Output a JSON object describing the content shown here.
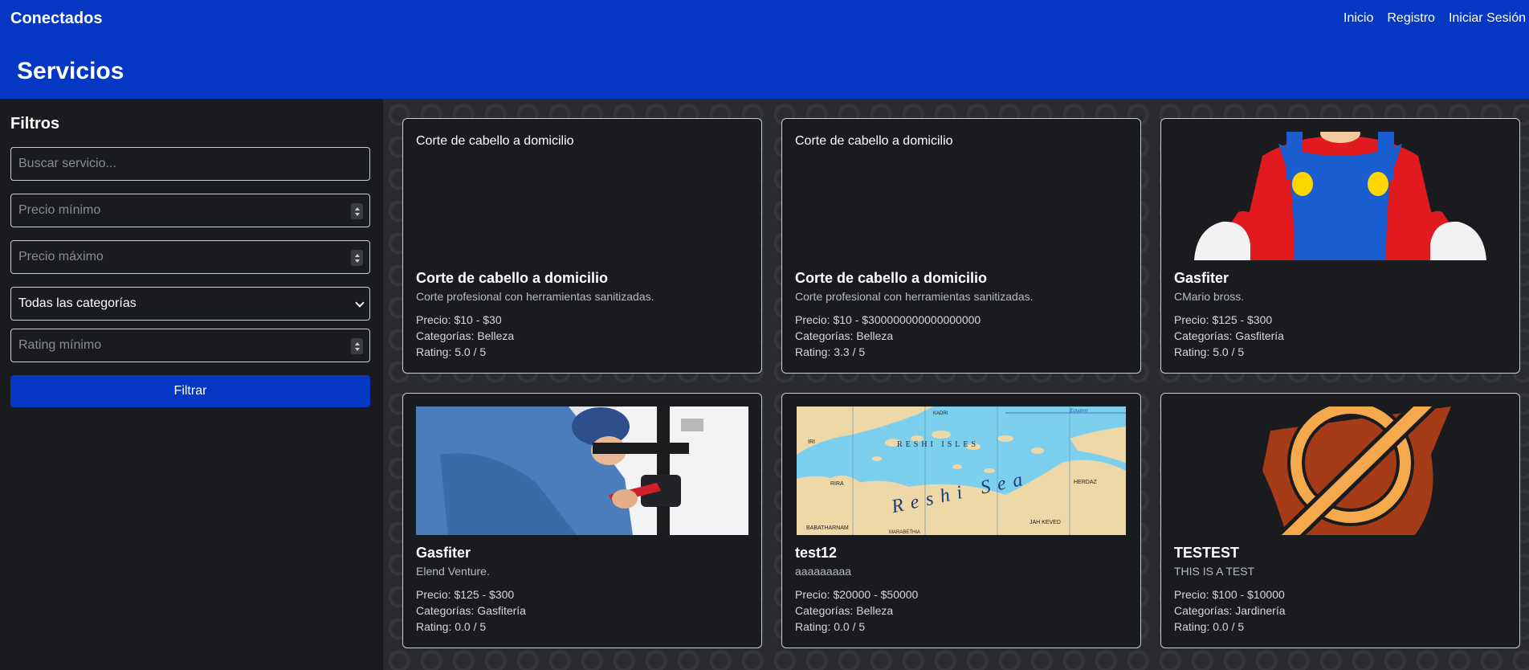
{
  "nav": {
    "brand": "Conectados",
    "links": [
      "Inicio",
      "Registro",
      "Iniciar Sesión"
    ]
  },
  "page": {
    "title": "Servicios"
  },
  "filters": {
    "heading": "Filtros",
    "search_placeholder": "Buscar servicio...",
    "min_price_placeholder": "Precio mínimo",
    "max_price_placeholder": "Precio máximo",
    "category_selected": "Todas las categorías",
    "min_rating_placeholder": "Rating mínimo",
    "button": "Filtrar"
  },
  "services": [
    {
      "image_alt": "Corte de cabello a domicilio",
      "title": "Corte de cabello a domicilio",
      "description": "Corte profesional con herramientas sanitizadas.",
      "price": "Precio: $10 - $30",
      "category": "Categorías: Belleza",
      "rating": "Rating: 5.0 / 5",
      "image": "none"
    },
    {
      "image_alt": "Corte de cabello a domicilio",
      "title": "Corte de cabello a domicilio",
      "description": "Corte profesional con herramientas sanitizadas.",
      "price": "Precio: $10 - $300000000000000000",
      "category": "Categorías: Belleza",
      "rating": "Rating: 3.3 / 5",
      "image": "none"
    },
    {
      "title": "Gasfiter",
      "description": "CMario bross.",
      "price": "Precio: $125 - $300",
      "category": "Categorías: Gasfitería",
      "rating": "Rating: 5.0 / 5",
      "image": "mario-figure"
    },
    {
      "title": "Gasfiter",
      "description": "Elend Venture.",
      "price": "Precio: $125 - $300",
      "category": "Categorías: Gasfitería",
      "rating": "Rating: 0.0 / 5",
      "image": "plumber-photo"
    },
    {
      "title": "test12",
      "description": "aaaaaaaaa",
      "price": "Precio: $20000 - $50000",
      "category": "Categorías: Belleza",
      "rating": "Rating: 0.0 / 5",
      "image": "map",
      "map_labels": {
        "equator": "Equator",
        "sea": "Reshi Sea",
        "isles": "RESHI ISLES",
        "kadri": "KADRI",
        "iri": "IRI",
        "rira": "RIRA",
        "herdaz": "HERDAZ",
        "babatharnam": "BABATHARNAM",
        "marabethia": "MARABETHIA",
        "jah_keved": "JAH KEVED"
      }
    },
    {
      "title": "TESTEST",
      "description": "THIS IS A TEST",
      "price": "Precio: $100 - $10000",
      "category": "Categorías: Jardinería",
      "rating": "Rating: 0.0 / 5",
      "image": "emblem"
    }
  ]
}
